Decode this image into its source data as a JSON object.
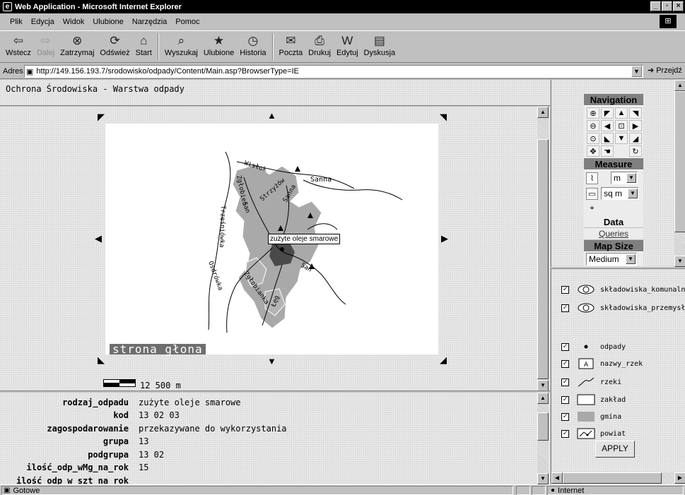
{
  "window": {
    "title": "Web Application - Microsoft Internet Explorer"
  },
  "menu": [
    "Plik",
    "Edycja",
    "Widok",
    "Ulubione",
    "Narzędzia",
    "Pomoc"
  ],
  "toolbar": {
    "back": "Wstecz",
    "forward": "Dalej",
    "stop": "Zatrzymaj",
    "refresh": "Odśwież",
    "home": "Start",
    "search": "Wyszukaj",
    "favorites": "Ulubione",
    "history": "Historia",
    "mail": "Poczta",
    "print": "Drukuj",
    "edit": "Edytuj",
    "discuss": "Dyskusja"
  },
  "address": {
    "label": "Adres",
    "url": "http://149.156.193.7/srodowisko/odpady/Content/Main.asp?BrowserType=IE",
    "go": "Przejdź"
  },
  "page_title": "Ochrona Środowiska - Warstwa odpady",
  "map": {
    "label": "strona głona",
    "tooltip": "zużyte oleje smarowe",
    "scale": "12 500 m",
    "rivers": [
      "Wisłok",
      "San",
      "Zgłobień",
      "Sanna",
      "Strzyżów",
      "Sanna",
      "Trześniówka",
      "Osdrówka",
      "Zgłobianka",
      "Łęg",
      "San"
    ]
  },
  "attributes": [
    {
      "key": "rodzaj_odpadu",
      "value": "zużyte oleje smarowe"
    },
    {
      "key": "kod",
      "value": "13 02 03"
    },
    {
      "key": "zagospodarowanie",
      "value": "przekazywane do wykorzystania"
    },
    {
      "key": "grupa",
      "value": "13"
    },
    {
      "key": "podgrupa",
      "value": "13 02"
    },
    {
      "key": "ilość_odp_wMg_na_rok",
      "value": "15"
    },
    {
      "key": "ilość_odp_w_szt_na_rok",
      "value": ""
    }
  ],
  "navigation": {
    "title": "Navigation",
    "measure_title": "Measure",
    "distance_unit": "m",
    "area_unit": "sq m",
    "data_title": "Data",
    "queries_link": "Queries",
    "mapsize_title": "Map Size",
    "mapsize_value": "Medium"
  },
  "legend": [
    {
      "name": "składowiska_komunalne",
      "symbol": "S"
    },
    {
      "name": "składowiska_przemysłowe",
      "symbol": "S"
    },
    {
      "name": "odpady",
      "symbol": "•"
    },
    {
      "name": "nazwy_rzek",
      "symbol": "A"
    },
    {
      "name": "rzeki",
      "symbol": "line"
    },
    {
      "name": "zakład",
      "symbol": "box"
    },
    {
      "name": "gmina",
      "symbol": "fill"
    },
    {
      "name": "powiat",
      "symbol": "poly"
    }
  ],
  "legend_apply": "APPLY",
  "status": {
    "text": "Gotowe",
    "zone": "Internet"
  },
  "colors": {
    "titlebar": "#000000",
    "chrome": "#c0c0c0",
    "map_area": "#a9a9a9",
    "nav_header": "#7f7f7f"
  }
}
